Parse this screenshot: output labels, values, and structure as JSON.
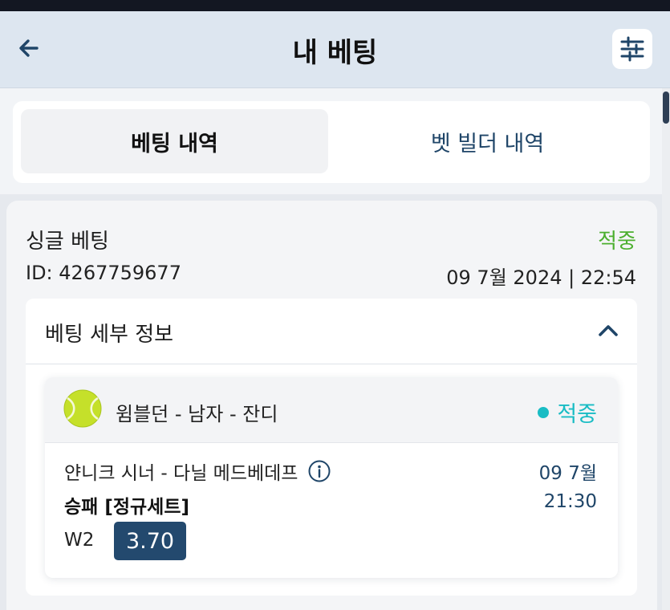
{
  "header": {
    "title": "내 베팅",
    "back_icon": "arrow-left-icon",
    "filter_icon": "sliders-icon"
  },
  "tabs": [
    {
      "label": "베팅 내역",
      "active": true
    },
    {
      "label": "벳 빌더 내역",
      "active": false
    }
  ],
  "bet": {
    "type": "싱글 베팅",
    "status": "적중",
    "id_text": "ID: 4267759677",
    "placed_at": "09 7월 2024 | 22:54",
    "details": {
      "title": "베팅 세부 정보",
      "collapse_icon": "chevron-up-icon",
      "event": {
        "sport_icon": "tennis-ball-icon",
        "tournament": "윔블던 - 남자 - 잔디",
        "status": "적중",
        "match": "얀니크 시너 - 다닐 메드베데프",
        "date": "09 7월",
        "market": "승패 [정규세트]",
        "time": "21:30",
        "outcome": "W2",
        "odds": "3.70"
      }
    }
  },
  "colors": {
    "won_green": "#4caf2f",
    "won_teal": "#19bcc4",
    "navy": "#1f4568",
    "odds_bg": "#23496e",
    "header_bg": "#dde6f0"
  }
}
